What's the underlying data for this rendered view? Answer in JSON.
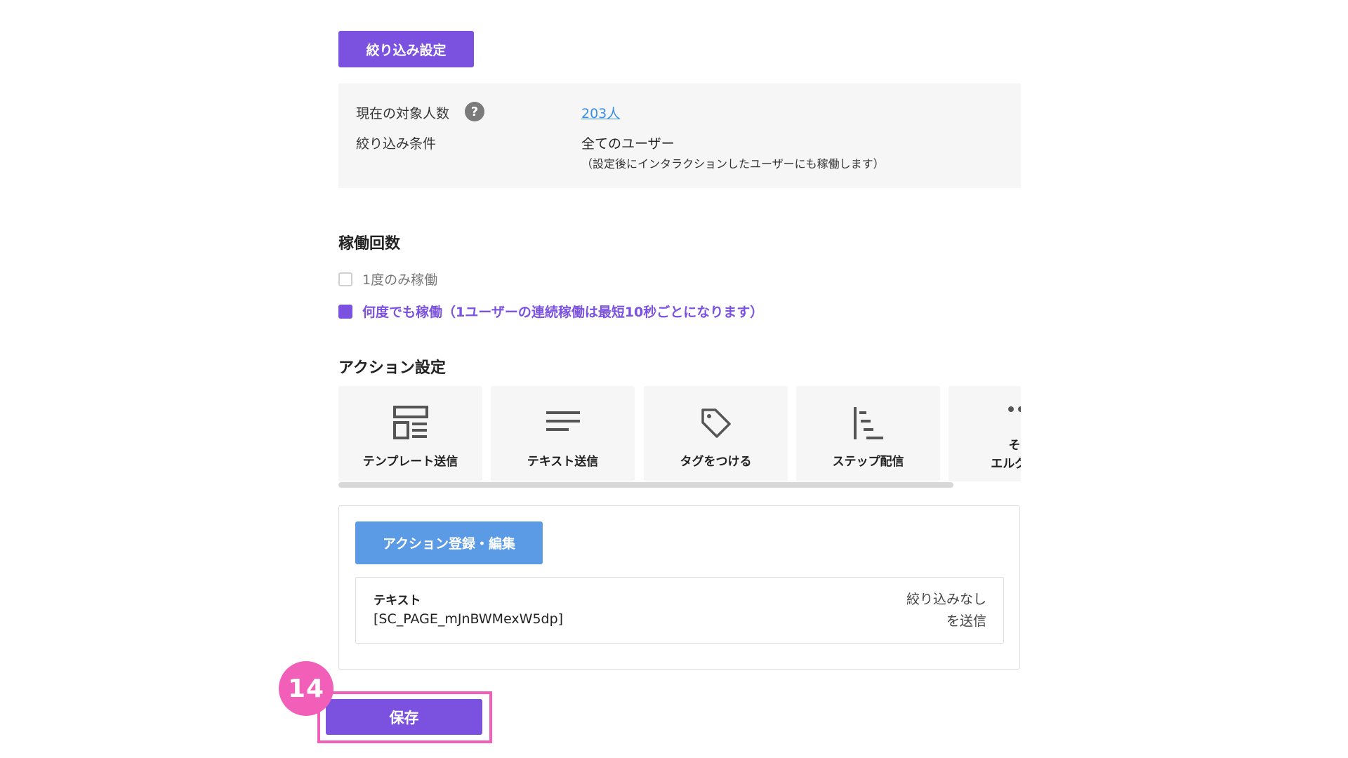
{
  "filter": {
    "button_label": "絞り込み設定",
    "current_count_label": "現在の対象人数",
    "help_icon": "question-icon",
    "help_symbol": "?",
    "current_count_value": "203人",
    "condition_label": "絞り込み条件",
    "condition_value": "全てのユーザー",
    "condition_note": "（設定後にインタラクションしたユーザーにも稼働します）"
  },
  "runs": {
    "title": "稼働回数",
    "options": [
      {
        "label": "1度のみ稼働",
        "checked": false
      },
      {
        "label": "何度でも稼働（1ユーザーの連続稼働は最短10秒ごとになります）",
        "checked": true
      }
    ]
  },
  "actions": {
    "title": "アクション設定",
    "tiles": [
      {
        "label": "テンプレート送信",
        "icon": "template-icon"
      },
      {
        "label": "テキスト送信",
        "icon": "text-lines-icon"
      },
      {
        "label": "タグをつける",
        "icon": "tag-icon"
      },
      {
        "label": "ステップ配信",
        "icon": "step-delivery-icon"
      },
      {
        "label_line1": "その",
        "label_line2": "エルグラム",
        "icon": "more-dots-icon"
      }
    ],
    "edit_button_label": "アクション登録・編集",
    "registered": {
      "type": "テキスト",
      "content": "[SC_PAGE_mJnBWMexW5dp]",
      "filter_line1": "絞り込みなし",
      "filter_line2": "を送信"
    }
  },
  "step_badge": "14",
  "save_button_label": "保存",
  "colors": {
    "primary_purple": "#7b52e0",
    "action_blue": "#5b9be6",
    "link_blue": "#3a8ee6",
    "highlight_pink": "#f25fb8",
    "panel_gray": "#f6f6f6"
  }
}
